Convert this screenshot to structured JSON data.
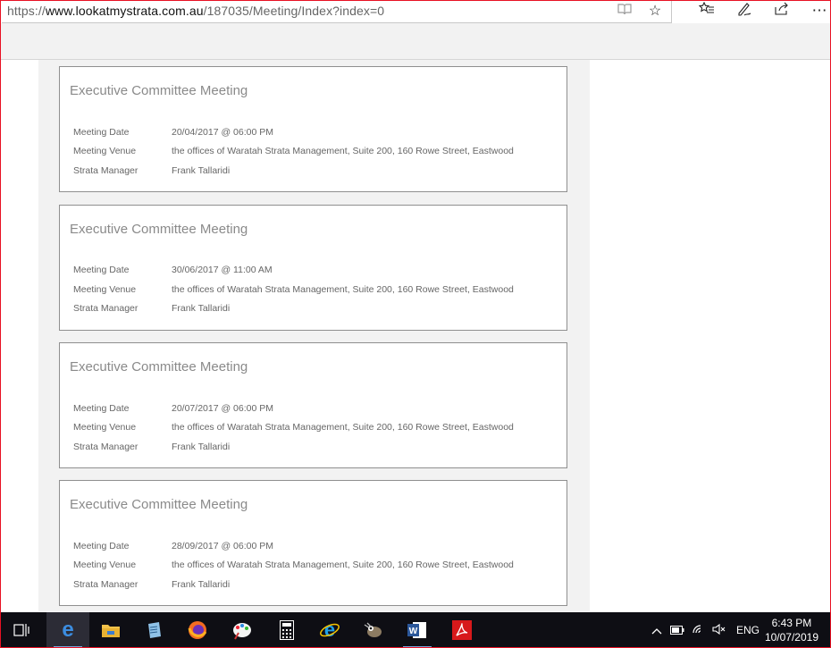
{
  "browser": {
    "url_prefix": "https://",
    "url_host": "www.lookatmystrata.com.au",
    "url_path": "/187035/Meeting/Index?index=0",
    "icons": {
      "reading_view": "book-icon",
      "favorite": "star-icon",
      "favorites_hub": "favorites-list-icon",
      "notes": "pen-icon",
      "share": "share-icon",
      "more": "ellipsis-icon"
    }
  },
  "meetings": [
    {
      "title": "Executive Committee Meeting",
      "date_label": "Meeting Date",
      "date": "20/04/2017 @ 06:00 PM",
      "venue_label": "Meeting Venue",
      "venue": "the offices of Waratah Strata Management, Suite 200, 160 Rowe Street, Eastwood",
      "manager_label": "Strata Manager",
      "manager": "Frank Tallaridi"
    },
    {
      "title": "Executive Committee Meeting",
      "date_label": "Meeting Date",
      "date": "30/06/2017 @ 11:00 AM",
      "venue_label": "Meeting Venue",
      "venue": "the offices of Waratah Strata Management, Suite 200, 160 Rowe Street, Eastwood",
      "manager_label": "Strata Manager",
      "manager": "Frank Tallaridi"
    },
    {
      "title": "Executive Committee Meeting",
      "date_label": "Meeting Date",
      "date": "20/07/2017 @ 06:00 PM",
      "venue_label": "Meeting Venue",
      "venue": "the offices of Waratah Strata Management, Suite 200, 160 Rowe Street, Eastwood",
      "manager_label": "Strata Manager",
      "manager": "Frank Tallaridi"
    },
    {
      "title": "Executive Committee Meeting",
      "date_label": "Meeting Date",
      "date": "28/09/2017 @ 06:00 PM",
      "venue_label": "Meeting Venue",
      "venue": "the offices of Waratah Strata Management, Suite 200, 160 Rowe Street, Eastwood",
      "manager_label": "Strata Manager",
      "manager": "Frank Tallaridi"
    }
  ],
  "taskbar": {
    "apps": [
      "task-view-icon",
      "edge-icon",
      "file-explorer-icon",
      "notepad-icon",
      "firefox-icon",
      "paint-icon",
      "calculator-icon",
      "internet-explorer-icon",
      "gimp-icon",
      "word-icon",
      "acrobat-icon"
    ],
    "tray": {
      "language": "ENG",
      "time": "6:43 PM",
      "date": "10/07/2019"
    }
  },
  "colors": {
    "accent_red": "#e81123",
    "taskbar_bg": "#0e0e14",
    "card_border": "#8f8f8f",
    "page_bg": "#f2f2f2"
  }
}
